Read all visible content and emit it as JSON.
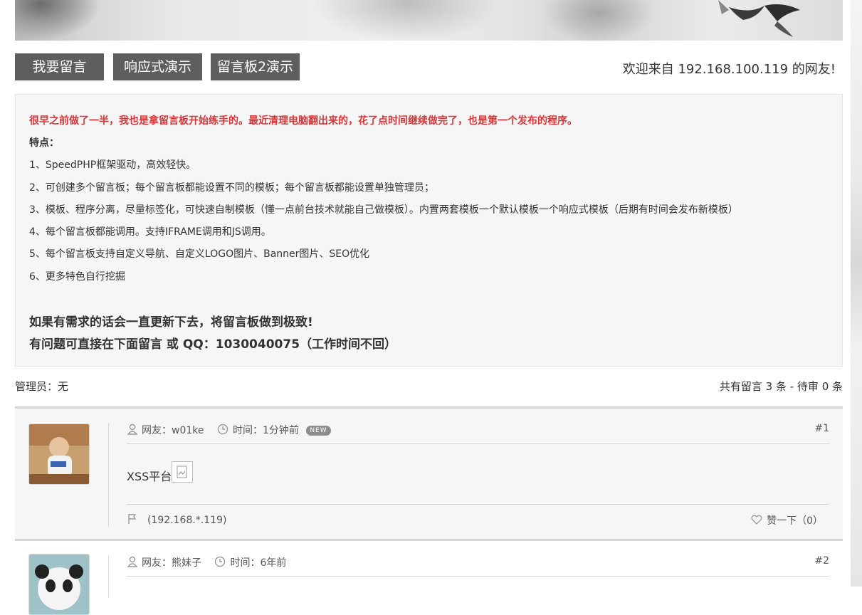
{
  "nav": {
    "buttons": [
      "我要留言",
      "响应式演示",
      "留言板2演示"
    ],
    "welcome": "欢迎来自 192.168.100.119 的网友!"
  },
  "notice": {
    "intro": "很早之前做了一半，我也是拿留言板开始练手的。最近清理电脑翻出来的，花了点时间继续做完了，也是第一个发布的程序。",
    "features_title": "特点：",
    "features": [
      "1、SpeedPHP框架驱动，高效轻快。",
      "2、可创建多个留言板；每个留言板都能设置不同的模板；每个留言板都能设置单独管理员；",
      "3、模板、程序分离，尽量标签化，可快速自制模板（懂一点前台技术就能自己做模板）。内置两套模板一个默认模板一个响应式模板（后期有时间会发布新模板）",
      "4、每个留言板都能调用。支持IFRAME调用和JS调用。",
      "5、每个留言板支持自定义导航、自定义LOGO图片、Banner图片、SEO优化",
      "6、更多特色自行挖掘"
    ],
    "promise": "如果有需求的话会一直更新下去，将留言板做到极致!",
    "contact": "有问题可直接在下面留言 或 QQ：1030040075（工作时间不回）"
  },
  "info": {
    "admin": "管理员：无",
    "count": "共有留言 3 条 - 待审 0 条"
  },
  "posts": [
    {
      "user": "网友：w01ke",
      "time": "时间：1分钟前",
      "badge": "NEW",
      "number": "#1",
      "content": "XSS平台",
      "ip": "(192.168.*.119)",
      "like": "赞一下（0）"
    },
    {
      "user": "网友：熊妹子",
      "time": "时间：6年前",
      "number": "#2"
    }
  ]
}
